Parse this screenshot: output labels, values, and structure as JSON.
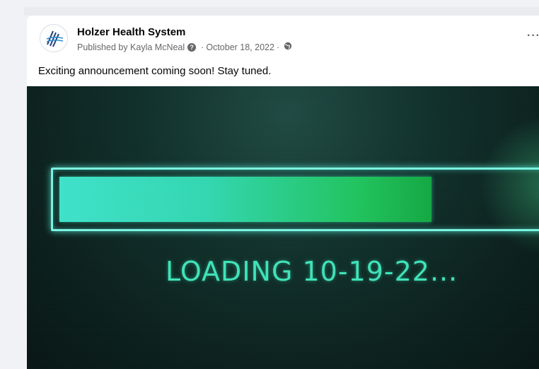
{
  "post": {
    "page_name": "Holzer Health System",
    "published_by": "Published by Kayla McNeal",
    "info_icon": "question-circle-icon",
    "date": "October 18, 2022",
    "separator": "·",
    "privacy_icon": "globe-icon",
    "more_label": "···",
    "text": "Exciting announcement coming soon! Stay tuned."
  },
  "media": {
    "loading_text": "LOADING 10-19-22...",
    "progress_fraction": 0.73,
    "colors": {
      "frame": "#7af2e0",
      "fill_start": "#3fe1c9",
      "fill_end": "#14a843",
      "text": "#3fe2b8"
    }
  }
}
